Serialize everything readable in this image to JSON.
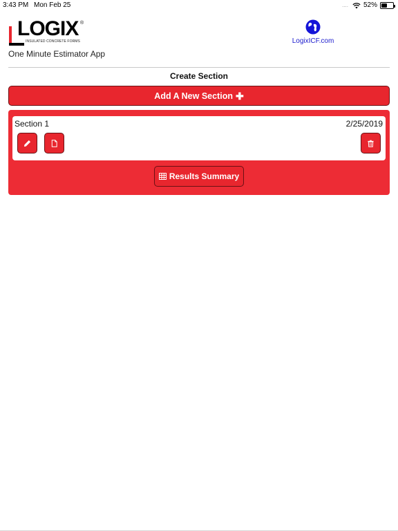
{
  "status_bar": {
    "time": "3:43 PM",
    "date": "Mon Feb 25",
    "signal_dots": "....",
    "battery_percent": "52%",
    "battery_level": 0.52
  },
  "header": {
    "logo_text": "LOGIX",
    "logo_reg": "®",
    "logo_tagline": "INSULATED CONCRETE FORMS",
    "app_name": "One Minute Estimator App",
    "site_link_label": "LogixICF.com",
    "site_link_icon": "globe-icon"
  },
  "main": {
    "heading": "Create Section",
    "add_section_label": "Add A New Section",
    "add_section_icon": "plus-icon",
    "sections": [
      {
        "title": "Section 1",
        "date": "2/25/2019",
        "actions": [
          "edit-icon",
          "document-icon",
          "trash-icon"
        ]
      }
    ],
    "results_summary_label": "Results Summary",
    "results_summary_icon": "table-icon"
  },
  "colors": {
    "accent_red": "#e8262e",
    "panel_red": "#ed2c35",
    "link_blue": "#1a1acd"
  }
}
